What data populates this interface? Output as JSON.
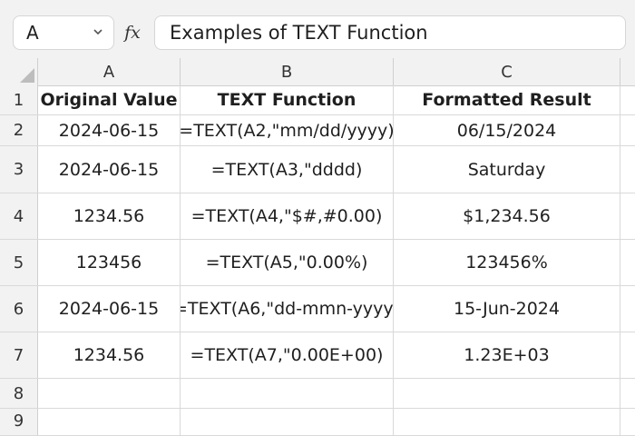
{
  "formula_bar": {
    "name_box": "A",
    "fx_label": "fx",
    "formula": "Examples of TEXT Function"
  },
  "columns": [
    "A",
    "B",
    "C"
  ],
  "rows": [
    {
      "num": "1",
      "cells": [
        "Original Value",
        "TEXT Function",
        "Formatted Result"
      ],
      "header": true
    },
    {
      "num": "2",
      "cells": [
        "2024-06-15",
        "=TEXT(A2,\"mm/dd/yyyy)",
        "06/15/2024"
      ]
    },
    {
      "num": "3",
      "cells": [
        "2024-06-15",
        "=TEXT(A3,\"dddd)",
        "Saturday"
      ]
    },
    {
      "num": "4",
      "cells": [
        "1234.56",
        "=TEXT(A4,\"$#,#0.00)",
        "$1,234.56"
      ]
    },
    {
      "num": "5",
      "cells": [
        "123456",
        "=TEXT(A5,\"0.00%)",
        "123456%"
      ]
    },
    {
      "num": "6",
      "cells": [
        "2024-06-15",
        "=TEXT(A6,\"dd-mmn-yyyy)",
        "15-Jun-2024"
      ]
    },
    {
      "num": "7",
      "cells": [
        "1234.56",
        "=TEXT(A7,\"0.00E+00)",
        "1.23E+03"
      ]
    },
    {
      "num": "8",
      "cells": [
        "",
        "",
        ""
      ]
    },
    {
      "num": "9",
      "cells": [
        "",
        "",
        ""
      ]
    }
  ]
}
